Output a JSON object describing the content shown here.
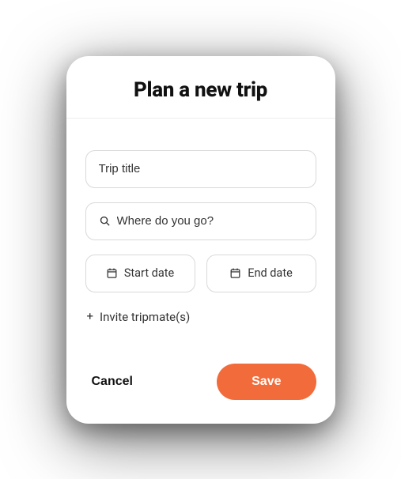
{
  "modal": {
    "title": "Plan a new trip",
    "fields": {
      "tripTitlePlaceholder": "Trip title",
      "destinationPlaceholder": "Where do you go?",
      "startDateLabel": "Start date",
      "endDateLabel": "End date",
      "inviteLabel": "Invite tripmate(s)"
    },
    "buttons": {
      "cancel": "Cancel",
      "save": "Save"
    }
  }
}
